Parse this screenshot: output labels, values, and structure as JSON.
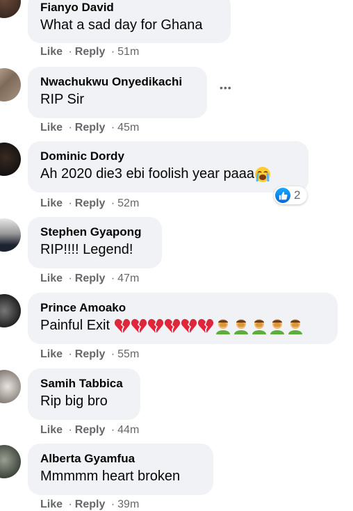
{
  "comments": [
    {
      "author": "Fianyo David",
      "text": "What a sad day for Ghana",
      "like": "Like",
      "reply": "Reply",
      "time": "51m"
    },
    {
      "author": "Nwachukwu Onyedikachi",
      "text": "RIP Sir",
      "like": "Like",
      "reply": "Reply",
      "time": "45m",
      "more": "•••"
    },
    {
      "author": "Dominic Dordy",
      "text": "Ah 2020 die3 ebi foolish year paaa",
      "like": "Like",
      "reply": "Reply",
      "time": "52m",
      "reaction_count": "2"
    },
    {
      "author": "Stephen Gyapong",
      "text": "RIP!!!! Legend!",
      "like": "Like",
      "reply": "Reply",
      "time": "47m"
    },
    {
      "author": "Prince Amoako",
      "text": "Painful Exit",
      "like": "Like",
      "reply": "Reply",
      "time": "55m"
    },
    {
      "author": "Samih Tabbica",
      "text": "Rip big bro",
      "like": "Like",
      "reply": "Reply",
      "time": "44m"
    },
    {
      "author": "Alberta Gyamfua",
      "text": "Mmmmm heart broken",
      "like": "Like",
      "reply": "Reply",
      "time": "39m"
    }
  ],
  "separator": "·",
  "icons": {
    "crying_emoji": "loudly-crying-face",
    "broken_heart": "broken-heart",
    "facepalm": "person-facepalming",
    "reaction": "like-icon"
  },
  "colors": {
    "bubble": "#f0f2f5",
    "meta": "#65676b",
    "like_blue": "#1877f2"
  }
}
